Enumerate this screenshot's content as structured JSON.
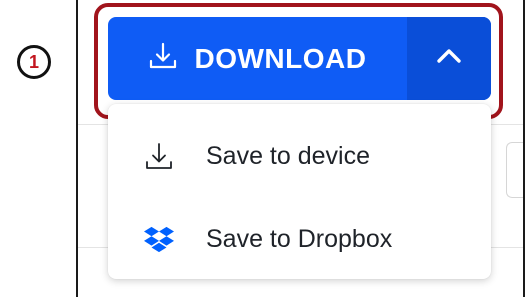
{
  "step_marker": {
    "number": "1"
  },
  "download_button": {
    "label": "DOWNLOAD",
    "icon": "download-icon",
    "toggle_icon": "chevron-up-icon",
    "state": "expanded"
  },
  "menu": {
    "items": [
      {
        "label": "Save to device",
        "icon": "download-icon"
      },
      {
        "label": "Save to Dropbox",
        "icon": "dropbox-icon"
      }
    ]
  },
  "colors": {
    "button_primary": "#0f5cf5",
    "button_toggle": "#0a4ed8",
    "highlight_outline": "#a1141c",
    "step_number": "#c2161f",
    "dropbox_blue": "#0061fe",
    "menu_text": "#1f2329"
  }
}
